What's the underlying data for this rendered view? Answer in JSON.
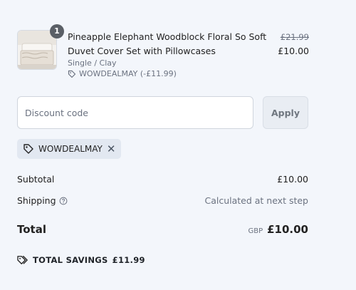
{
  "product": {
    "quantity": "1",
    "title": "Pineapple Elephant Woodblock Floral So Soft Duvet Cover Set with Pillowcases",
    "variant": "Single / Clay",
    "discount_line": "WOWDEALMAY (-£11.99)",
    "compare_price": "£21.99",
    "price": "£10.00"
  },
  "discount_form": {
    "placeholder": "Discount code",
    "apply_label": "Apply"
  },
  "applied_code": {
    "code": "WOWDEALMAY"
  },
  "summary": {
    "subtotal_label": "Subtotal",
    "subtotal_value": "£10.00",
    "shipping_label": "Shipping",
    "shipping_value": "Calculated at next step",
    "total_label": "Total",
    "total_currency": "GBP",
    "total_value": "£10.00"
  },
  "savings": {
    "label": "TOTAL SAVINGS",
    "value": "£11.99"
  },
  "icons": {
    "tag": "tag-icon",
    "close": "close-icon",
    "help": "question-circle-icon",
    "savings": "tags-icon"
  }
}
